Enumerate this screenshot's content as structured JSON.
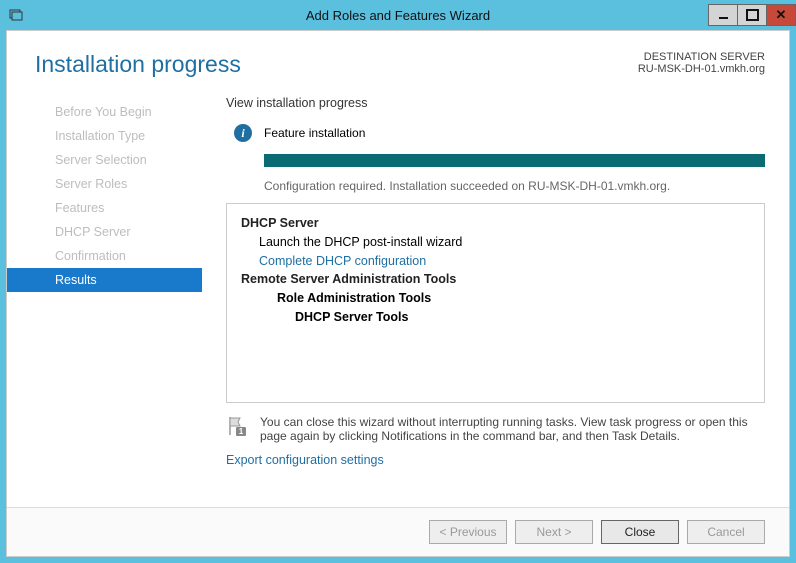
{
  "titlebar": {
    "title": "Add Roles and Features Wizard"
  },
  "header": {
    "page_title": "Installation progress",
    "dest_label": "DESTINATION SERVER",
    "dest_server": "RU-MSK-DH-01.vmkh.org"
  },
  "sidebar": {
    "items": [
      {
        "label": "Before You Begin",
        "active": false
      },
      {
        "label": "Installation Type",
        "active": false
      },
      {
        "label": "Server Selection",
        "active": false
      },
      {
        "label": "Server Roles",
        "active": false
      },
      {
        "label": "Features",
        "active": false
      },
      {
        "label": "DHCP Server",
        "active": false
      },
      {
        "label": "Confirmation",
        "active": false
      },
      {
        "label": "Results",
        "active": true
      }
    ]
  },
  "content": {
    "view_label": "View installation progress",
    "feature_label": "Feature installation",
    "status_text": "Configuration required. Installation succeeded on RU-MSK-DH-01.vmkh.org.",
    "results": {
      "role": "DHCP Server",
      "launch_text": "Launch the DHCP post-install wizard",
      "complete_link": "Complete DHCP configuration",
      "tools_header": "Remote Server Administration Tools",
      "tools_sub": "Role Administration Tools",
      "tools_leaf": "DHCP Server Tools"
    },
    "note": "You can close this wizard without interrupting running tasks. View task progress or open this page again by clicking Notifications in the command bar, and then Task Details.",
    "export_link": "Export configuration settings"
  },
  "footer": {
    "previous": "< Previous",
    "next": "Next >",
    "close": "Close",
    "cancel": "Cancel"
  }
}
